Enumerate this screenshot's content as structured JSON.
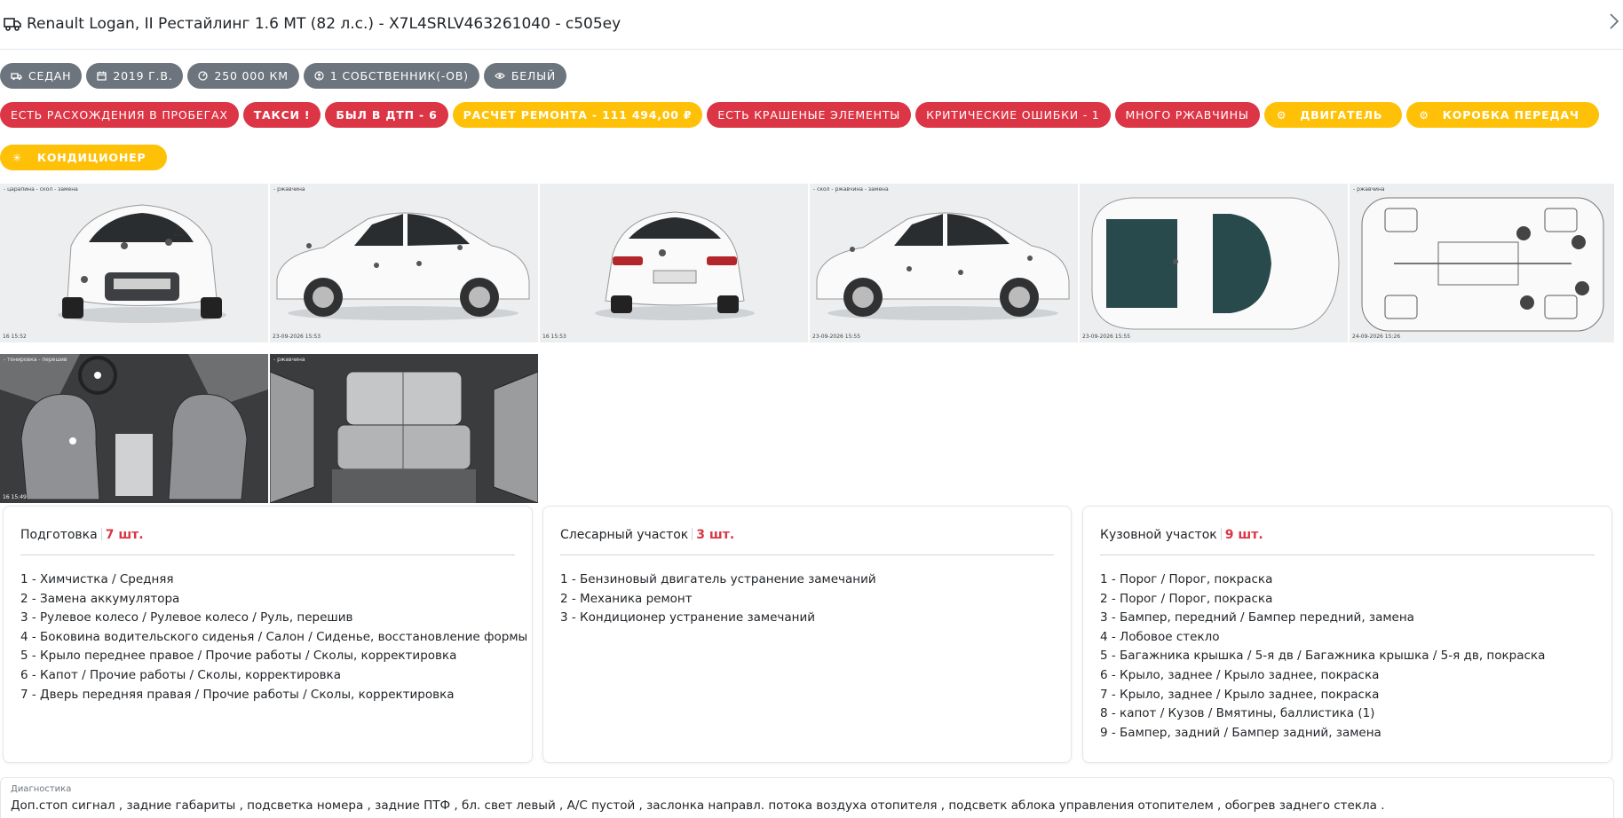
{
  "header": {
    "title": "Renault Logan, II Рестайлинг 1.6 MT (82 л.с.) - X7L4SRLV463261040 - с505еу",
    "close_icon": "chevron-right-icon"
  },
  "info_chips": [
    {
      "label": "Седан",
      "icon": "car-icon"
    },
    {
      "label": "2019 г.в.",
      "icon": "calendar-icon"
    },
    {
      "label": "250 000 км",
      "icon": "speedometer-icon"
    },
    {
      "label": "1 собственник(-ов)",
      "icon": "user-circle-icon"
    },
    {
      "label": "Белый",
      "icon": "eye-icon"
    }
  ],
  "warning_chips": [
    {
      "label": "Есть расхождения в пробегах",
      "color": "#dc3545"
    },
    {
      "label": "Такси !",
      "color": "#dc3545"
    },
    {
      "label": "Был в ДТП - 6",
      "color": "#dc3545"
    },
    {
      "label": "Расчет ремонта - 111 494,00 ₽",
      "color": "#ffc107"
    },
    {
      "label": "Есть крашеные элементы",
      "color": "#dc3545"
    },
    {
      "label": "Критические ошибки - 1",
      "color": "#dc3545"
    },
    {
      "label": "Много ржавчины",
      "color": "#dc3545"
    },
    {
      "label": "Двигатель",
      "color": "#ffc107",
      "icon": "engine-icon"
    },
    {
      "label": "Коробка передач",
      "color": "#ffc107",
      "icon": "gearbox-icon"
    },
    {
      "label": "Кондиционер",
      "color": "#ffc107",
      "icon": "snowflake-icon"
    }
  ],
  "gallery": {
    "stamps": [
      "16 15:52",
      "23-09-2026 15:53",
      "16 15:53",
      "23-09-2026 15:55",
      "23-09-2026 15:55",
      "24-09-2026 15:26",
      "16 15:49",
      ""
    ],
    "legends": [
      "- царапина  - скол  - замена",
      "- ржавчина",
      "",
      "- скол  - ржавчина  - замена",
      "",
      "- ржавчина",
      "- тонировка  - перешив",
      "- ржавчина"
    ]
  },
  "cards": [
    {
      "title": "Подготовка",
      "count": "7 шт.",
      "items": [
        "1 - Химчистка / Средняя",
        "2 - Замена аккумулятора",
        "3 - Рулевое колесо / Рулевое колесо / Руль, перешив",
        "4 - Боковина водительского сиденья / Салон / Сиденье, восстановление формы",
        "5 - Крыло переднее правое / Прочие работы / Сколы, корректировка",
        "6 - Капот / Прочие работы / Сколы, корректировка",
        "7 - Дверь передняя правая / Прочие работы / Сколы, корректировка"
      ]
    },
    {
      "title": "Слесарный участок",
      "count": "3 шт.",
      "items": [
        "1 - Бензиновый двигатель устранение замечаний",
        "2 - Механика ремонт",
        "3 - Кондиционер устранение замечаний"
      ]
    },
    {
      "title": "Кузовной участок",
      "count": "9 шт.",
      "items": [
        "1 - Порог / Порог, покраска",
        "2 - Порог / Порог, покраска",
        "3 - Бампер, передний / Бампер передний, замена",
        "4 - Лобовое стекло",
        "5 - Багажника крышка / 5-я дв / Багажника крышка / 5-я дв, покраска",
        "6 - Крыло, заднее / Крыло заднее, покраска",
        "7 - Крыло, заднее / Крыло заднее, покраска",
        "8 - капот / Кузов / Вмятины, баллистика (1)",
        "9 - Бампер, задний / Бампер задний, замена"
      ]
    }
  ],
  "diagnostics": {
    "label": "Диагностика",
    "text": "Доп.стоп сигнал , задние габариты , подсветка номера , задние ПТФ , бл. свет левый , А/С пустой , заслонка направл. потока воздуха отопителя , подсветк аблока управления отопителем , обогрев заднего стекла ."
  }
}
